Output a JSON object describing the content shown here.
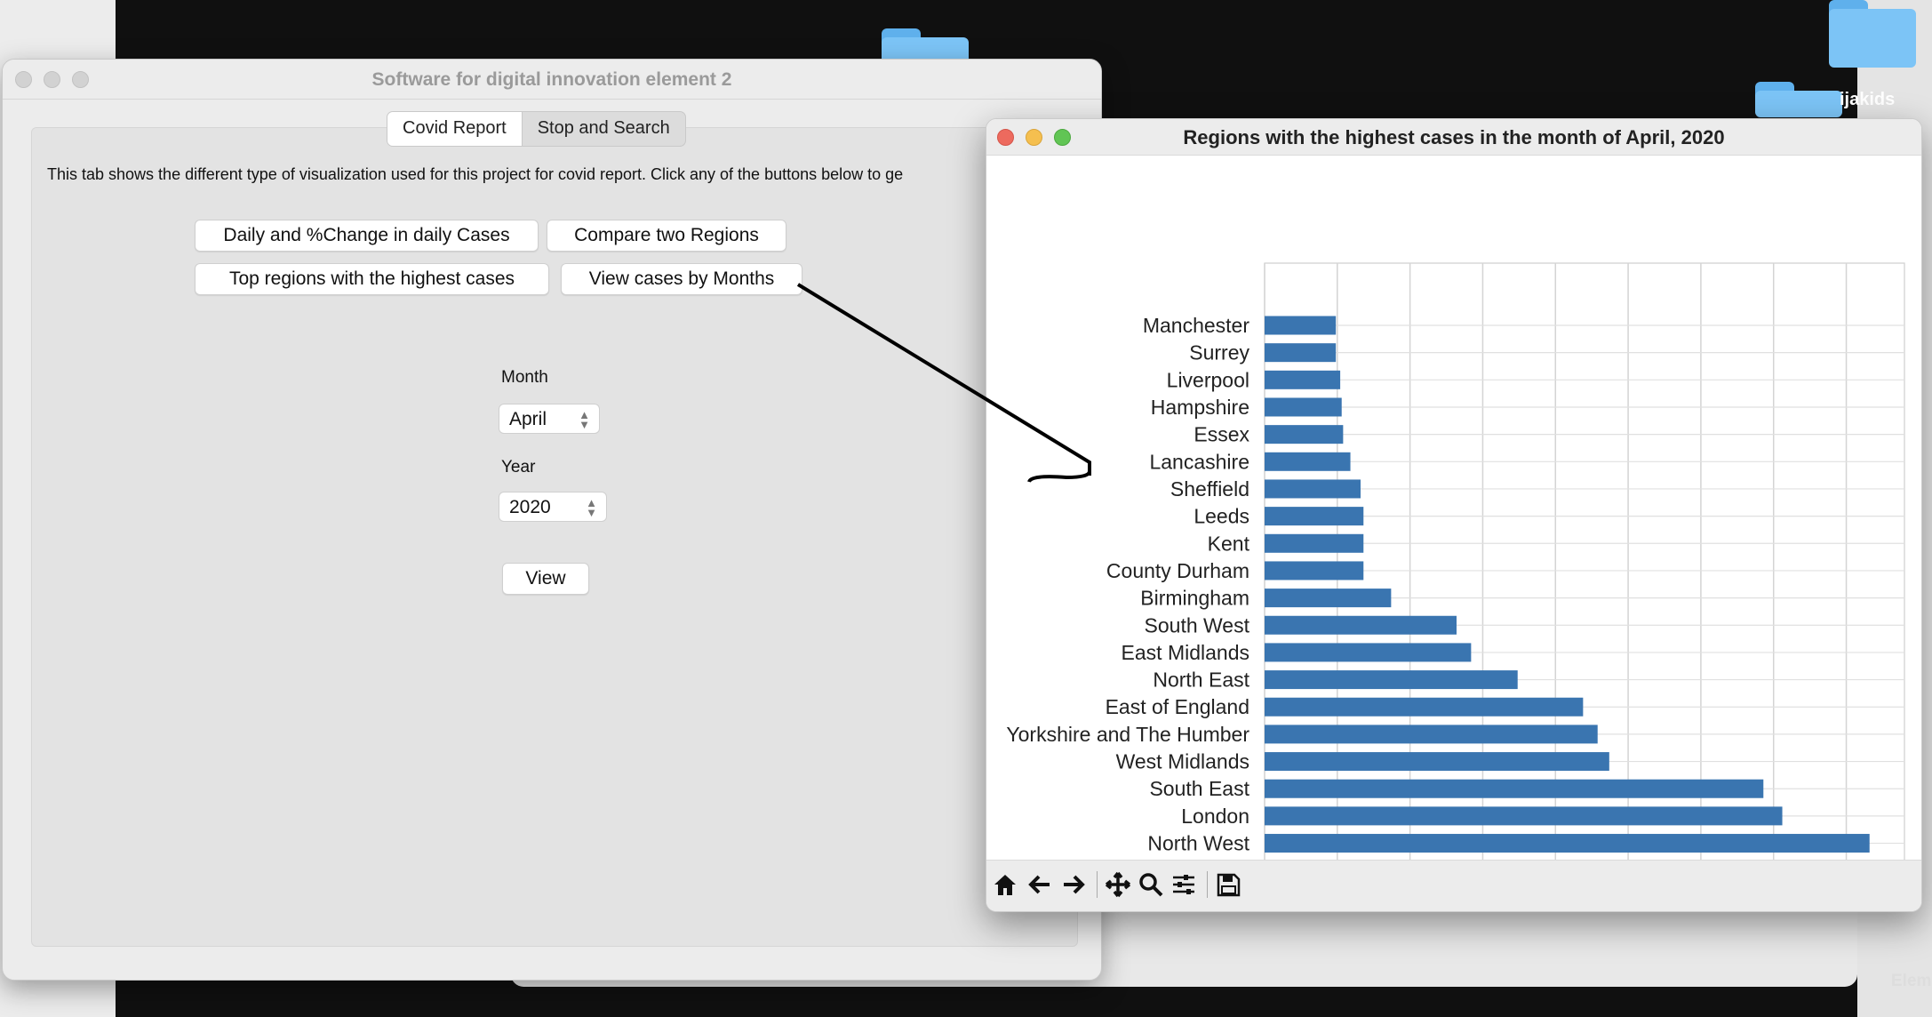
{
  "desktop": {
    "folder_label": "ijakids",
    "corner_label": "Elem"
  },
  "main_window": {
    "title": "Software for digital innovation element 2",
    "tabs": [
      {
        "label": "Covid Report",
        "active": true
      },
      {
        "label": "Stop and Search",
        "active": false
      }
    ],
    "intro_text": "This tab shows the different type of visualization used for this project for covid report. Click any of the buttons below to ge",
    "buttons": {
      "daily": "Daily and %Change in daily Cases",
      "compare": "Compare two Regions",
      "top_regions": "Top regions with the highest cases",
      "by_months": "View cases by Months"
    },
    "month": {
      "label": "Month",
      "value": "April"
    },
    "year": {
      "label": "Year",
      "value": "2020"
    },
    "view_button": "View"
  },
  "chart_window": {
    "title": "Regions with the highest cases in the month of April, 2020",
    "toolbar": [
      "home-icon",
      "back-icon",
      "forward-icon",
      "pan-icon",
      "zoom-icon",
      "configure-icon",
      "save-icon"
    ]
  },
  "chart_data": {
    "type": "bar",
    "orientation": "horizontal",
    "categories": [
      "Manchester",
      "Surrey",
      "Liverpool",
      "Hampshire",
      "Essex",
      "Lancashire",
      "Sheffield",
      "Leeds",
      "Kent",
      "County Durham",
      "Birmingham",
      "South West",
      "East Midlands",
      "North East",
      "East of England",
      "Yorkshire and The Humber",
      "West Midlands",
      "South East",
      "London",
      "North West"
    ],
    "values": [
      2450,
      2450,
      2600,
      2650,
      2700,
      2950,
      3300,
      3400,
      3400,
      3400,
      4350,
      6600,
      7100,
      8700,
      10950,
      11450,
      11850,
      17150,
      17800,
      20800
    ],
    "xticks": [
      "0",
      "2500",
      "5000",
      "7500",
      "10000",
      "12500",
      "15000",
      "17500",
      "20000"
    ],
    "xlim": [
      0,
      22000
    ],
    "grid": true,
    "bar_color": "#3a75b0"
  }
}
